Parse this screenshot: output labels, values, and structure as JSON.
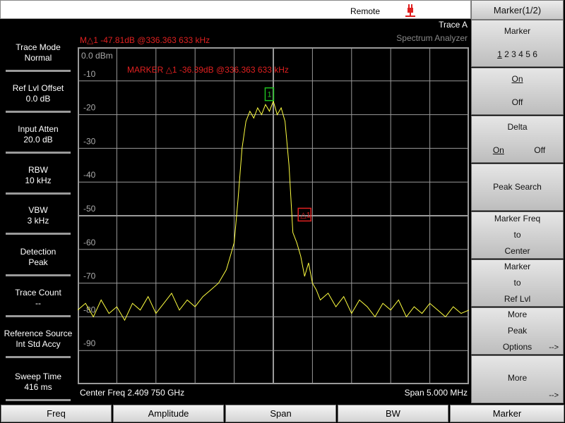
{
  "status_bar": {
    "remote": "Remote"
  },
  "left_panel": [
    {
      "title": "Trace Mode",
      "value": "Normal"
    },
    {
      "title": "Ref Lvl Offset",
      "value": "0.0 dB"
    },
    {
      "title": "Input Atten",
      "value": "20.0 dB"
    },
    {
      "title": "RBW",
      "value": "10 kHz"
    },
    {
      "title": "VBW",
      "value": "3 kHz"
    },
    {
      "title": "Detection",
      "value": "Peak"
    },
    {
      "title": "Trace Count",
      "value": "--"
    },
    {
      "title": "Reference Source",
      "value": "Int Std Accy"
    },
    {
      "title": "Sweep Time",
      "value": "416 ms"
    }
  ],
  "display": {
    "trace": "Trace A",
    "mode": "Spectrum Analyzer",
    "marker_readout": "M△1 -47.81dB @336.363 633 kHz",
    "marker_annotation": "MARKER △1 -36.39dB @336.363 633 kHz",
    "ref_level": "0.0 dBm",
    "y_ticks": [
      "-10",
      "-20",
      "-30",
      "-40",
      "-50",
      "-60",
      "-70",
      "-80",
      "-90"
    ],
    "center_freq": "Center Freq 2.409 750 GHz",
    "span": "Span 5.000 MHz",
    "marker1_label": "1",
    "delta_label": "△1",
    "colors": {
      "trace": "#ffff40",
      "grid": "#9a9a9a",
      "marker": "#e02020",
      "marker1": "#20c020"
    }
  },
  "chart_data": {
    "type": "line",
    "ylim": [
      -100,
      0
    ],
    "yunit": "dBm",
    "center_freq_ghz": 2.40975,
    "span_mhz": 5.0,
    "series": [
      {
        "x_mhz": [
          -2.5,
          -2.4,
          -2.3,
          -2.2,
          -2.1,
          -2.0,
          -1.9,
          -1.8,
          -1.7,
          -1.6,
          -1.5,
          -1.4,
          -1.3,
          -1.2,
          -1.1,
          -1.0,
          -0.9,
          -0.8,
          -0.7,
          -0.6,
          -0.55,
          -0.5,
          -0.45,
          -0.4,
          -0.35,
          -0.3,
          -0.25,
          -0.2,
          -0.15,
          -0.1,
          -0.05,
          0.0,
          0.05,
          0.1,
          0.15,
          0.2,
          0.25,
          0.3,
          0.35,
          0.4,
          0.45,
          0.5,
          0.55,
          0.6,
          0.7,
          0.8,
          0.9,
          1.0,
          1.1,
          1.2,
          1.3,
          1.4,
          1.5,
          1.6,
          1.7,
          1.8,
          1.9,
          2.0,
          2.1,
          2.2,
          2.3,
          2.4,
          2.5
        ],
        "y": [
          -78,
          -76,
          -80,
          -75,
          -79,
          -77,
          -81,
          -76,
          -78,
          -74,
          -79,
          -76,
          -73,
          -78,
          -75,
          -77,
          -74,
          -72,
          -70,
          -66,
          -62,
          -58,
          -45,
          -30,
          -22,
          -19,
          -21,
          -18,
          -20,
          -17,
          -19,
          -16,
          -20,
          -18,
          -22,
          -35,
          -55,
          -58,
          -62,
          -68,
          -64,
          -70,
          -72,
          -75,
          -73,
          -77,
          -74,
          -79,
          -75,
          -77,
          -80,
          -76,
          -78,
          -75,
          -80,
          -77,
          -79,
          -76,
          -78,
          -80,
          -77,
          -79,
          -78
        ]
      }
    ],
    "marker1": {
      "x_mhz": -0.05,
      "y": -17.5
    },
    "delta_marker": {
      "x_mhz": 0.336,
      "y": -54.9
    }
  },
  "right_panel": {
    "title": "Marker(1/2)",
    "marker": {
      "label": "Marker",
      "numbers": [
        "1",
        "2",
        "3",
        "4",
        "5",
        "6"
      ]
    },
    "on_off": {
      "on": "On",
      "off": "Off"
    },
    "delta": {
      "label": "Delta",
      "on": "On",
      "off": "Off"
    },
    "peak_search": "Peak Search",
    "marker_freq": [
      "Marker Freq",
      "to",
      "Center"
    ],
    "marker_ref": [
      "Marker",
      "to",
      "Ref Lvl"
    ],
    "more_peak": [
      "More",
      "Peak",
      "Options"
    ],
    "more_peak_arrow": "-->",
    "more": "More",
    "more_arrow": "-->"
  },
  "tabs": [
    "Freq",
    "Amplitude",
    "Span",
    "BW",
    "Marker"
  ]
}
